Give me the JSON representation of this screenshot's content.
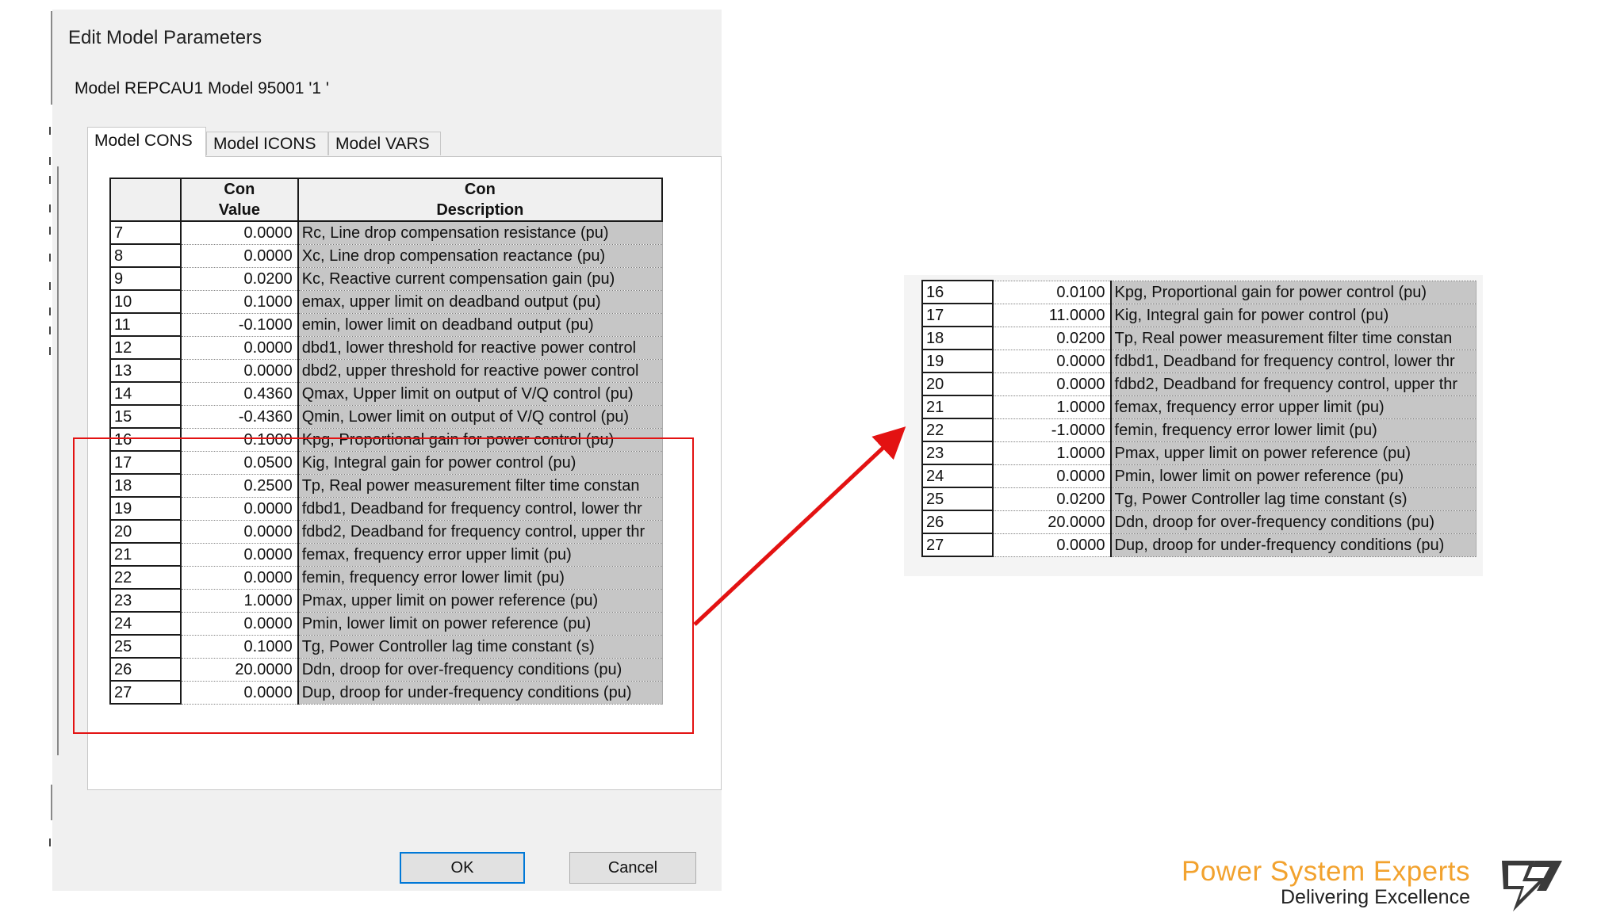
{
  "dialog": {
    "title": "Edit Model Parameters",
    "model_line": "Model REPCAU1 Model 95001 '1 '",
    "tabs": [
      {
        "label": "Model CONS"
      },
      {
        "label": "Model ICONS"
      },
      {
        "label": "Model VARS"
      }
    ],
    "table": {
      "headers": {
        "value_line1": "Con",
        "value_line2": "Value",
        "desc_line1": "Con",
        "desc_line2": "Description"
      },
      "rows": [
        {
          "idx": "7",
          "value": "0.0000",
          "desc": "Rc, Line drop compensation resistance (pu)"
        },
        {
          "idx": "8",
          "value": "0.0000",
          "desc": "Xc, Line drop compensation reactance (pu)"
        },
        {
          "idx": "9",
          "value": "0.0200",
          "desc": "Kc, Reactive current compensation gain (pu)"
        },
        {
          "idx": "10",
          "value": "0.1000",
          "desc": "emax, upper limit on deadband output (pu)"
        },
        {
          "idx": "11",
          "value": "-0.1000",
          "desc": "emin, lower limit on deadband output (pu)"
        },
        {
          "idx": "12",
          "value": "0.0000",
          "desc": "dbd1, lower threshold for reactive power control"
        },
        {
          "idx": "13",
          "value": "0.0000",
          "desc": "dbd2, upper threshold for reactive power control"
        },
        {
          "idx": "14",
          "value": "0.4360",
          "desc": "Qmax, Upper limit on output of V/Q control (pu)"
        },
        {
          "idx": "15",
          "value": "-0.4360",
          "desc": "Qmin, Lower limit on output of V/Q control (pu)"
        },
        {
          "idx": "16",
          "value": "0.1000",
          "desc": "Kpg, Proportional gain for power control (pu)"
        },
        {
          "idx": "17",
          "value": "0.0500",
          "desc": "Kig, Integral gain for power control (pu)"
        },
        {
          "idx": "18",
          "value": "0.2500",
          "desc": "Tp, Real power measurement filter time constan"
        },
        {
          "idx": "19",
          "value": "0.0000",
          "desc": "fdbd1, Deadband for frequency control, lower thr"
        },
        {
          "idx": "20",
          "value": "0.0000",
          "desc": "fdbd2, Deadband for frequency control, upper thr"
        },
        {
          "idx": "21",
          "value": "0.0000",
          "desc": "femax, frequency error upper limit (pu)"
        },
        {
          "idx": "22",
          "value": "0.0000",
          "desc": "femin, frequency error lower limit (pu)"
        },
        {
          "idx": "23",
          "value": "1.0000",
          "desc": "Pmax, upper limit on power reference (pu)"
        },
        {
          "idx": "24",
          "value": "0.0000",
          "desc": "Pmin, lower limit on power reference (pu)"
        },
        {
          "idx": "25",
          "value": "0.1000",
          "desc": "Tg, Power Controller lag time constant (s)"
        },
        {
          "idx": "26",
          "value": "20.0000",
          "desc": "Ddn, droop for over-frequency conditions (pu)"
        },
        {
          "idx": "27",
          "value": "0.0000",
          "desc": "Dup, droop for under-frequency conditions (pu)"
        }
      ]
    },
    "ok_label": "OK",
    "cancel_label": "Cancel"
  },
  "updated_table": {
    "rows": [
      {
        "idx": "16",
        "value": "0.0100",
        "desc": "Kpg, Proportional gain for power control (pu)"
      },
      {
        "idx": "17",
        "value": "11.0000",
        "desc": "Kig, Integral gain for power control (pu)"
      },
      {
        "idx": "18",
        "value": "0.0200",
        "desc": "Tp, Real power measurement filter time constan"
      },
      {
        "idx": "19",
        "value": "0.0000",
        "desc": "fdbd1, Deadband for frequency control, lower thr"
      },
      {
        "idx": "20",
        "value": "0.0000",
        "desc": "fdbd2, Deadband for frequency control, upper thr"
      },
      {
        "idx": "21",
        "value": "1.0000",
        "desc": "femax, frequency error upper limit (pu)"
      },
      {
        "idx": "22",
        "value": "-1.0000",
        "desc": "femin, frequency error lower limit (pu)"
      },
      {
        "idx": "23",
        "value": "1.0000",
        "desc": "Pmax, upper limit on power reference (pu)"
      },
      {
        "idx": "24",
        "value": "0.0000",
        "desc": "Pmin, lower limit on power reference (pu)"
      },
      {
        "idx": "25",
        "value": "0.0200",
        "desc": "Tg, Power Controller lag time constant (s)"
      },
      {
        "idx": "26",
        "value": "20.0000",
        "desc": "Ddn, droop for over-frequency conditions (pu)"
      },
      {
        "idx": "27",
        "value": "0.0000",
        "desc": "Dup, droop for under-frequency conditions (pu)"
      }
    ]
  },
  "annotation": {
    "highlight_color": "#e31212",
    "arrow_color": "#e31212"
  },
  "brand": {
    "name": "Power System Experts",
    "tagline": "Delivering Excellence",
    "accent_color": "#f2a22e",
    "logo_icon": "lightning-bolt-logo-icon"
  }
}
